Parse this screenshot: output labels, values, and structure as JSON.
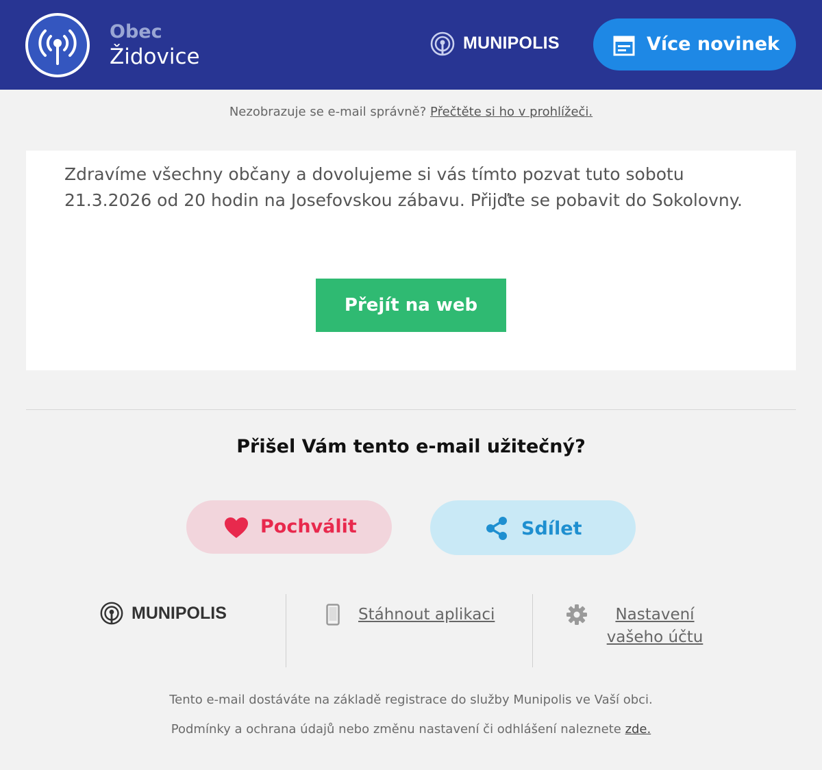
{
  "header": {
    "town_label": "Obec",
    "town_name": "Židovice",
    "brand": "MUNIPOLIS",
    "more_news_label": "Více novinek",
    "colors": {
      "background": "#283593",
      "button": "#1e88e5"
    }
  },
  "preheader": {
    "text": "Nezobrazuje se e-mail správně?",
    "link": "Přečtěte si ho v prohlížeči."
  },
  "message": {
    "body": "Zdravíme všechny občany a dovolujeme si vás tímto pozvat tuto sobotu 21.3.2026 od 20 hodin na Josefovskou zábavu. Přijďte se pobavit do Sokolovny.",
    "cta_label": "Přejít na web",
    "cta_color": "#2fba72"
  },
  "feedback": {
    "question": "Přišel Vám tento e-mail užitečný?",
    "praise_label": "Pochválit",
    "share_label": "Sdílet",
    "praise_icon": "heart-icon",
    "share_icon": "share-icon"
  },
  "footer": {
    "brand": "MUNIPOLIS",
    "app_link": "Stáhnout aplikaci",
    "settings_link": "Nastavení vašeho účtu",
    "registration_notice": "Tento e-mail dostáváte na základě registrace do služby Munipolis ve Vaší obci.",
    "terms_text": "Podmínky a ochrana údajů nebo změnu nastavení či odhlášení naleznete",
    "terms_link": "zde."
  }
}
